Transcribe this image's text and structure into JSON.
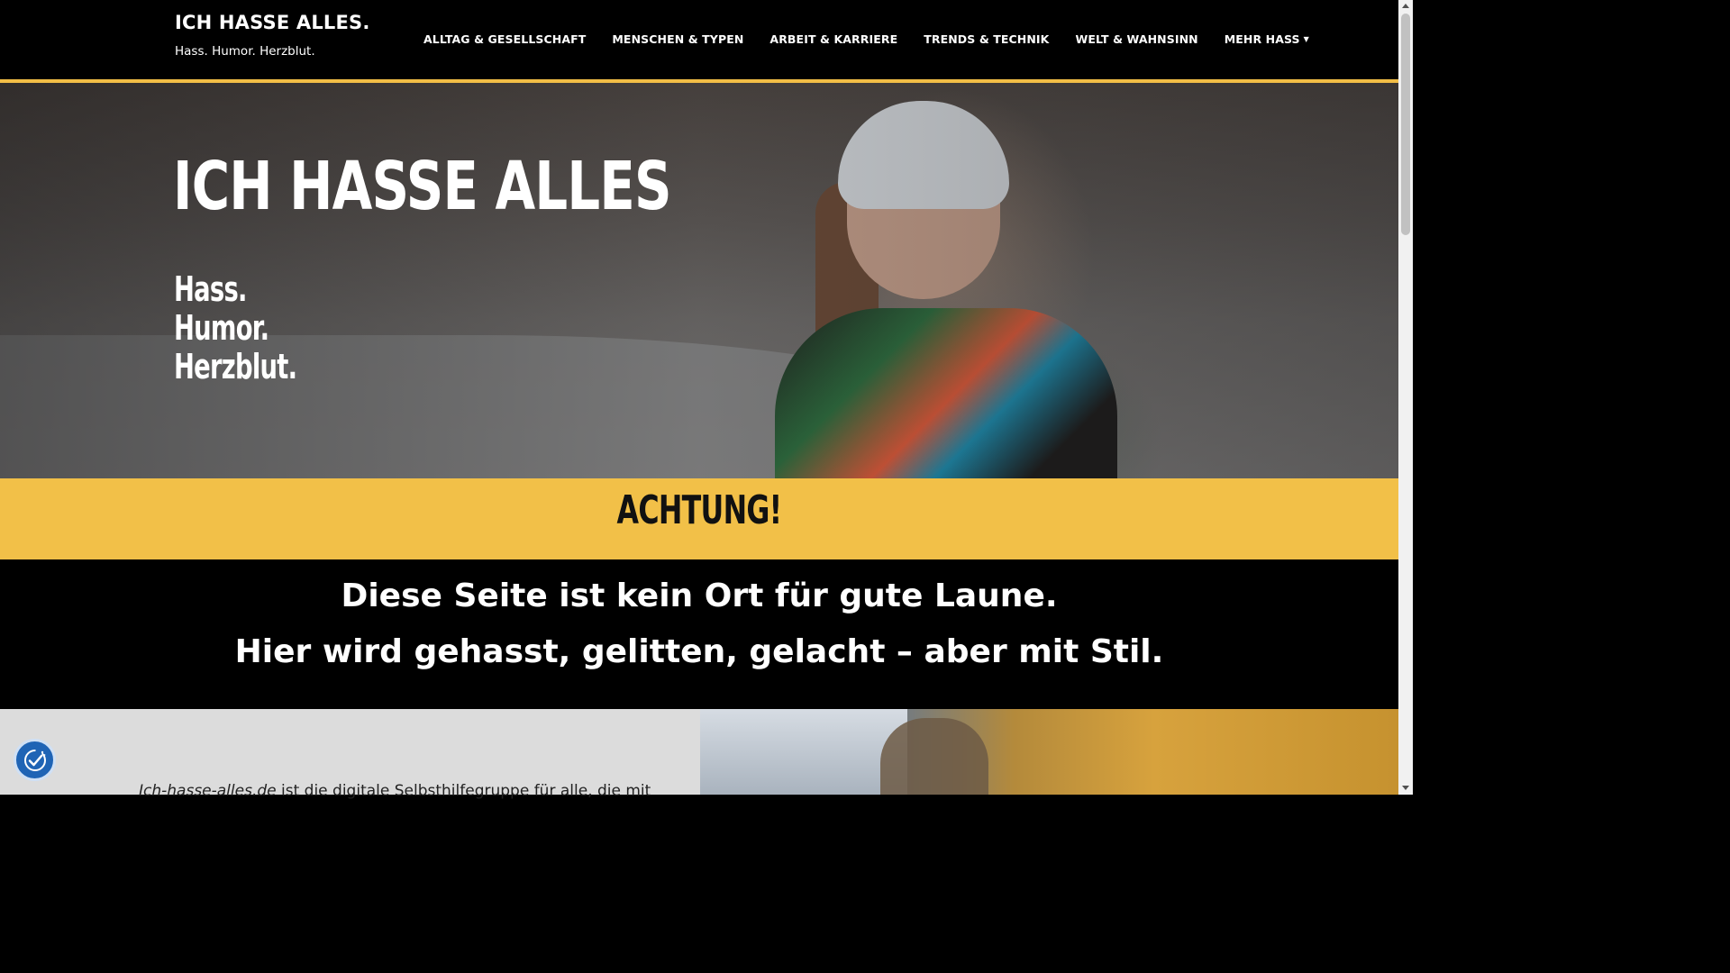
{
  "header": {
    "site_title": "ICH HASSE ALLES.",
    "tagline": "Hass. Humor. Herzblut.",
    "nav": [
      {
        "label": "ALLTAG & GESELLSCHAFT"
      },
      {
        "label": "MENSCHEN & TYPEN"
      },
      {
        "label": "ARBEIT & KARRIERE"
      },
      {
        "label": "TRENDS & TECHNIK"
      },
      {
        "label": "WELT & WAHNSINN"
      },
      {
        "label": "MEHR HASS",
        "icon": "chevron-down-icon"
      }
    ]
  },
  "hero": {
    "title": "ICH HASSE ALLES",
    "subtitle_lines": [
      "Hass.",
      "Humor.",
      "Herzblut."
    ]
  },
  "alert": {
    "title": "ACHTUNG!"
  },
  "message": {
    "line1": "Diese Seite ist kein Ort für gute Laune.",
    "line2": "Hier wird gehasst, gelitten, gelacht – aber mit Stil."
  },
  "intro": {
    "site_name": "Ich-hasse-alles.de",
    "text": " ist die digitale Selbsthilfegruppe für alle, die mit"
  },
  "consent": {
    "icon": "cookie-consent-icon"
  },
  "colors": {
    "accent_yellow": "#f2c048",
    "header_bg": "#000000",
    "consent_blue": "#1f64b5"
  }
}
